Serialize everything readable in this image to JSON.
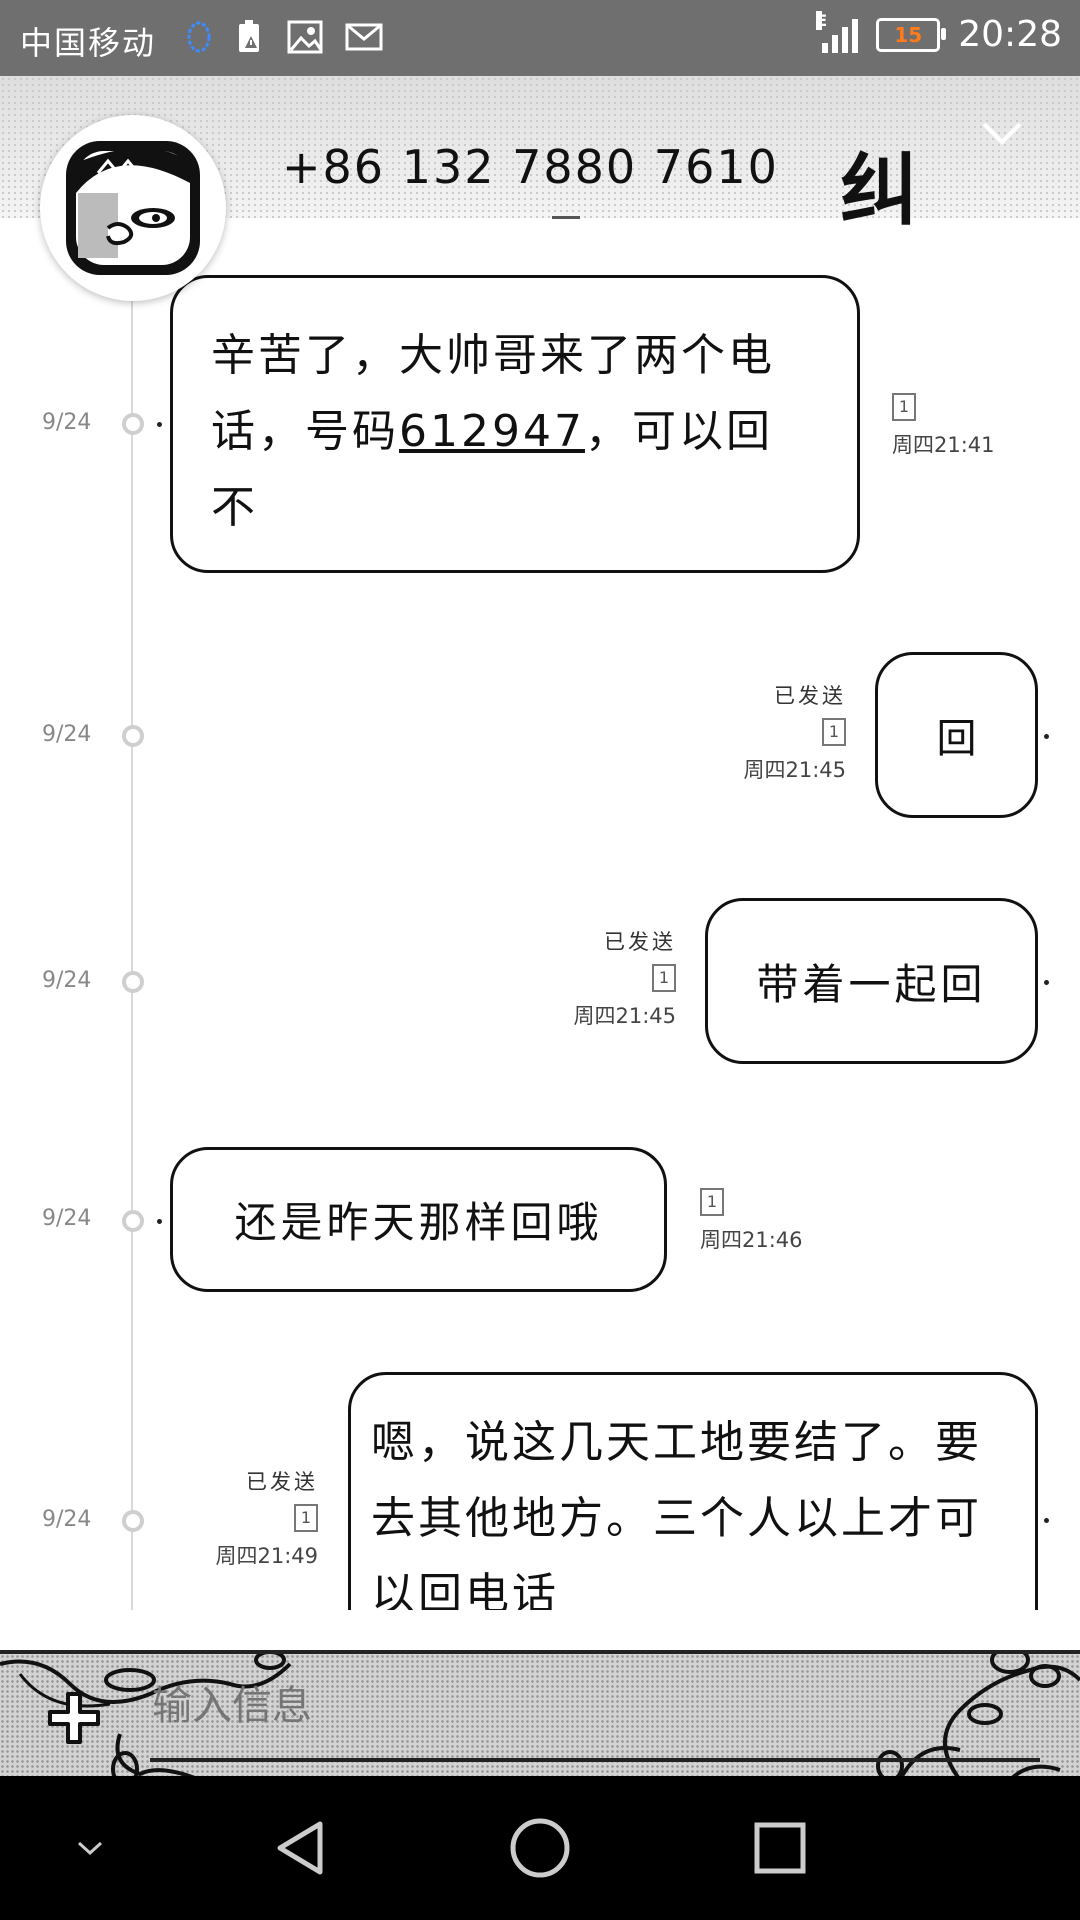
{
  "status_bar": {
    "carrier": "中国移动",
    "network_type": "E",
    "battery_level": "15",
    "time": "20:28",
    "icons": [
      "qq-icon",
      "battery-warning-icon",
      "image-icon",
      "mail-icon"
    ]
  },
  "header": {
    "contact_number": "+86 132 7880 7610",
    "tag_text": "纠"
  },
  "messages": [
    {
      "date": "9/24",
      "direction": "received",
      "text_before_link": "辛苦了，大帅哥来了两个电话，号码",
      "link": "612947",
      "text_after_link": "，可以回不",
      "sim": "1",
      "time": "周四21:41"
    },
    {
      "date": "9/24",
      "direction": "sent",
      "status": "已发送",
      "text": "回",
      "sim": "1",
      "time": "周四21:45"
    },
    {
      "date": "9/24",
      "direction": "sent",
      "status": "已发送",
      "text": "带着一起回",
      "sim": "1",
      "time": "周四21:45"
    },
    {
      "date": "9/24",
      "direction": "received",
      "text": "还是昨天那样回哦",
      "sim": "1",
      "time": "周四21:46"
    },
    {
      "date": "9/24",
      "direction": "sent",
      "status": "已发送",
      "text": "嗯，说这几天工地要结了。要去其他地方。三个人以上才可以回电话",
      "sim": "1",
      "time": "周四21:49"
    }
  ],
  "composer": {
    "placeholder": "输入信息"
  },
  "colors": {
    "status_bar": "#6f6f6f",
    "battery_text": "#ff7a1a",
    "bubble_border": "#111111",
    "nav_bar": "#000000"
  }
}
